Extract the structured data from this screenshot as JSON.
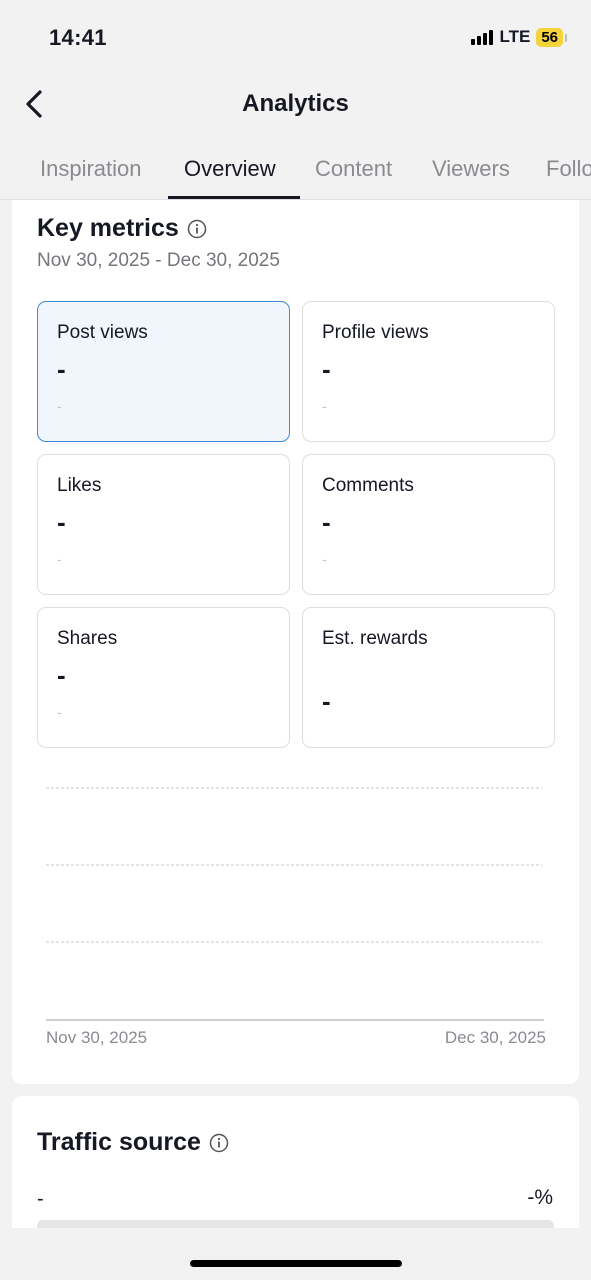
{
  "status_bar": {
    "time": "14:41",
    "network": "LTE",
    "battery": "56"
  },
  "header": {
    "title": "Analytics",
    "back_icon": "chevron-left-icon"
  },
  "tabs": [
    {
      "label": "Inspiration",
      "active": false
    },
    {
      "label": "Overview",
      "active": true
    },
    {
      "label": "Content",
      "active": false
    },
    {
      "label": "Viewers",
      "active": false
    },
    {
      "label": "Followers",
      "active": false
    }
  ],
  "key_metrics": {
    "title": "Key metrics",
    "info_icon": "info-icon",
    "date_range": "Nov 30, 2025 - Dec 30, 2025",
    "metrics": [
      {
        "label": "Post views",
        "value": "-",
        "sub": "-",
        "selected": true
      },
      {
        "label": "Profile views",
        "value": "-",
        "sub": "-",
        "selected": false
      },
      {
        "label": "Likes",
        "value": "-",
        "sub": "-",
        "selected": false
      },
      {
        "label": "Comments",
        "value": "-",
        "sub": "-",
        "selected": false
      },
      {
        "label": "Shares",
        "value": "-",
        "sub": "-",
        "selected": false
      },
      {
        "label": "Est. rewards",
        "value": "-",
        "sub": "",
        "selected": false
      }
    ]
  },
  "chart_data": {
    "type": "line",
    "x": [
      "Nov 30, 2025",
      "Dec 30, 2025"
    ],
    "series": [],
    "grid": true,
    "title": "",
    "xlabel": "",
    "ylabel": ""
  },
  "traffic_source": {
    "title": "Traffic source",
    "info_icon": "info-icon",
    "rows": [
      {
        "label": "-",
        "value": "-%"
      }
    ]
  },
  "colors": {
    "accent": "#3f8bd6",
    "selected_bg": "#f1f6fd",
    "battery": "#f5d33a"
  }
}
